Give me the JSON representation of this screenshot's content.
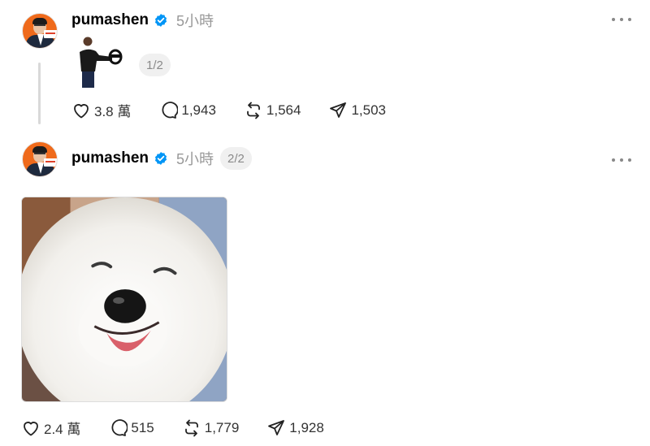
{
  "posts": [
    {
      "username": "pumashen",
      "time": "5小時",
      "media_counter": "1/2",
      "stats": {
        "likes": "3.8 萬",
        "replies": "1,943",
        "reposts": "1,564",
        "shares": "1,503"
      }
    },
    {
      "username": "pumashen",
      "time": "5小時",
      "post_counter": "2/2",
      "stats": {
        "likes": "2.4 萬",
        "replies": "515",
        "reposts": "1,779",
        "shares": "1,928"
      }
    }
  ],
  "icons": [
    "verified-badge-icon",
    "more-options-icon",
    "heart-icon",
    "comment-icon",
    "repost-icon",
    "share-icon"
  ],
  "colors": {
    "verified": "#0095f6",
    "muted_text": "#999999",
    "avatar_bg": "#ef6a1b"
  }
}
